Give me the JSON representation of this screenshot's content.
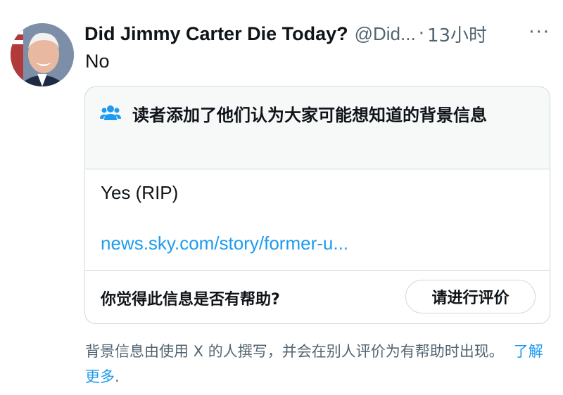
{
  "tweet": {
    "author_name": "Did Jimmy Carter Die Today?",
    "author_handle": "@Did...",
    "separator": "·",
    "time": "13小时",
    "more_label": "···",
    "text": "No"
  },
  "community_note": {
    "header": "读者添加了他们认为大家可能想知道的背景信息",
    "body": "Yes (RIP)",
    "link_text": "news.sky.com/story/former-u...",
    "helpful_question": "你觉得此信息是否有帮助?",
    "rate_button": "请进行评价",
    "icon": "people-icon",
    "accent_color": "#1d9bf0"
  },
  "footer": {
    "text": "背景信息由使用 X 的人撰写，并会在别人评价为有帮助时出现。",
    "learn_more": "了解更多",
    "period": "."
  }
}
